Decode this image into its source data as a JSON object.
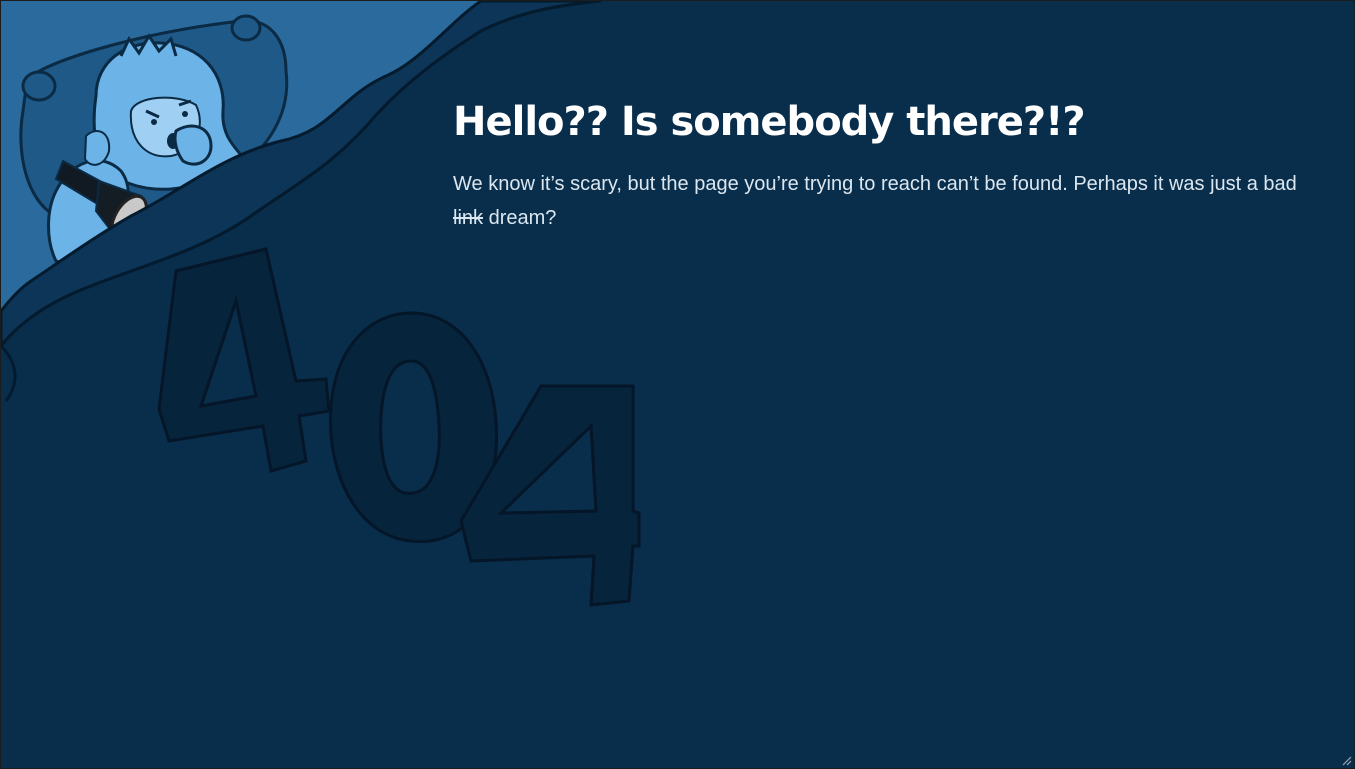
{
  "error_page": {
    "title": "Hello?? Is somebody there?!?",
    "message_before": "We know it’s scary, but the page you’re trying to reach can’t be found. Perhaps it was just a bad",
    "struck_word": "link",
    "message_after": "dream?",
    "illustration": {
      "character": "yeti-in-bed",
      "held_item": "flashlight",
      "big_number": "404"
    }
  },
  "colors": {
    "background": "#092e4c",
    "blanket": "#0d3a5e",
    "blanket_dark": "#072540",
    "yeti": "#6cb3e8",
    "title": "#ffffff",
    "text": "#dbe6ef"
  }
}
